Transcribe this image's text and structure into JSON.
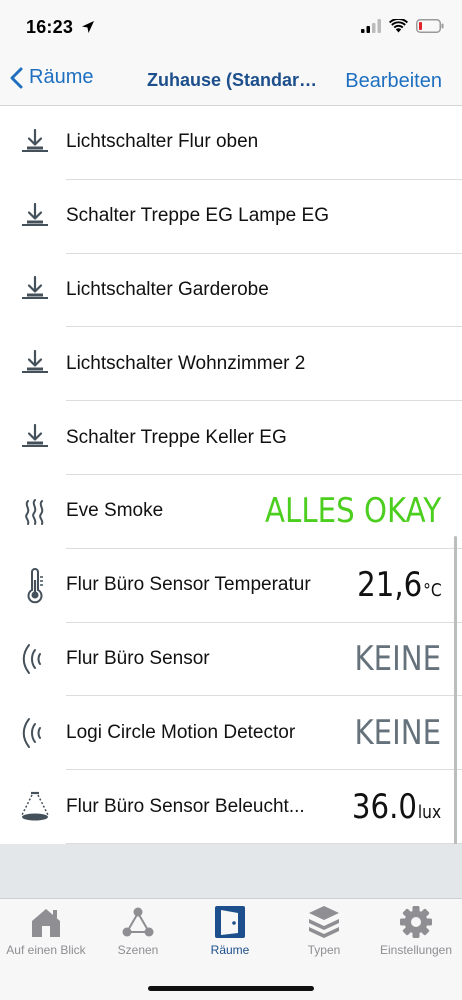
{
  "status": {
    "time": "16:23"
  },
  "nav": {
    "back_label": "Räume",
    "title": "Zuhause (Standard...",
    "edit_label": "Bearbeiten"
  },
  "rows": [
    {
      "icon": "switch-icon",
      "label": "Lichtschalter Flur oben",
      "value": "",
      "unit": ""
    },
    {
      "icon": "switch-icon",
      "label": "Schalter Treppe EG Lampe EG",
      "value": "",
      "unit": ""
    },
    {
      "icon": "switch-icon",
      "label": "Lichtschalter Garderobe",
      "value": "",
      "unit": ""
    },
    {
      "icon": "switch-icon",
      "label": "Lichtschalter Wohnzimmer 2",
      "value": "",
      "unit": ""
    },
    {
      "icon": "switch-icon",
      "label": "Schalter Treppe Keller EG",
      "value": "",
      "unit": ""
    },
    {
      "icon": "smoke-icon",
      "label": "Eve Smoke",
      "value": "ALLES OKAY",
      "unit": ""
    },
    {
      "icon": "thermometer-icon",
      "label": "Flur Büro Sensor Temperatur",
      "value": "21,6",
      "unit": "°C"
    },
    {
      "icon": "motion-icon",
      "label": "Flur Büro Sensor",
      "value": "KEINE",
      "unit": ""
    },
    {
      "icon": "motion-icon",
      "label": "Logi Circle Motion Detector",
      "value": "KEINE",
      "unit": ""
    },
    {
      "icon": "light-sensor-icon",
      "label": "Flur Büro Sensor Beleucht...",
      "value": "36.0",
      "unit": "lux"
    }
  ],
  "tabs": [
    {
      "icon": "home-icon",
      "label": "Auf einen Blick",
      "active": false
    },
    {
      "icon": "scenes-icon",
      "label": "Szenen",
      "active": false
    },
    {
      "icon": "door-icon",
      "label": "Räume",
      "active": true
    },
    {
      "icon": "layers-icon",
      "label": "Typen",
      "active": false
    },
    {
      "icon": "gear-icon",
      "label": "Einstellungen",
      "active": false
    }
  ],
  "colors": {
    "accent": "#1e6fc0",
    "title": "#1d4f8c",
    "ok_green": "#4cce1f",
    "value_grey": "#66727b"
  }
}
